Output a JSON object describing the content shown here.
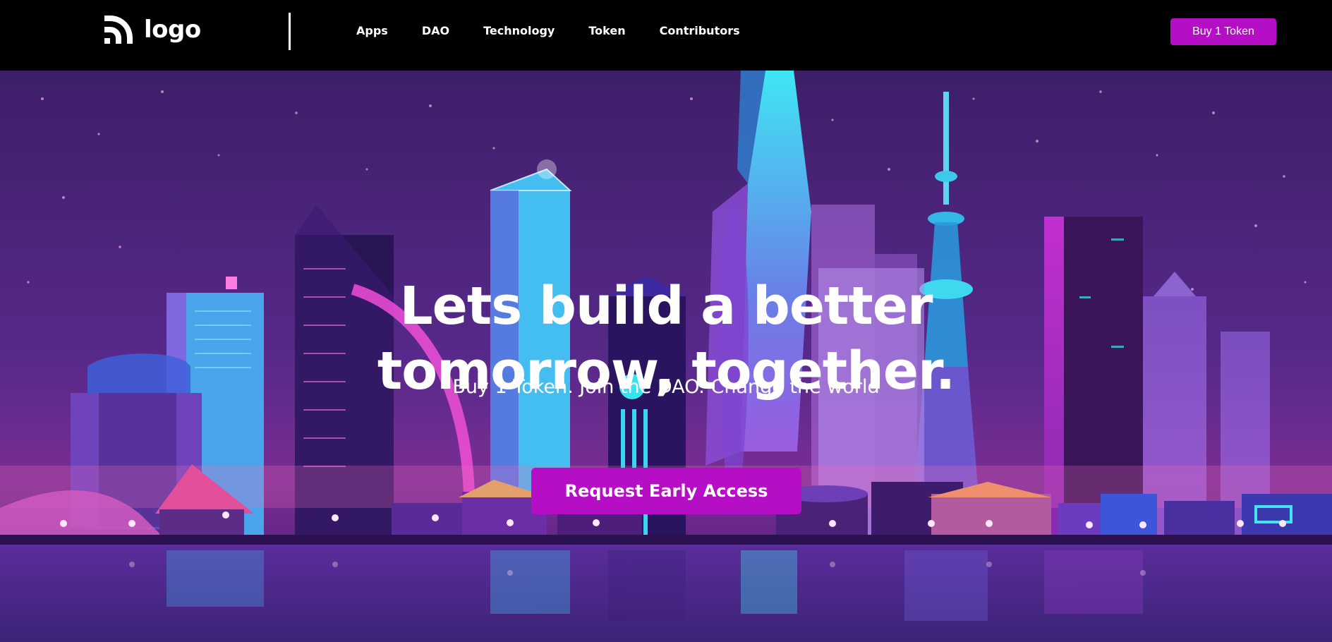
{
  "header": {
    "logo_text": "logo",
    "nav": [
      {
        "label": "Apps"
      },
      {
        "label": "DAO"
      },
      {
        "label": "Technology"
      },
      {
        "label": "Token"
      },
      {
        "label": "Contributors"
      }
    ],
    "cta_label": "Buy 1 Token"
  },
  "hero": {
    "title_line1": "Lets build a better",
    "title_line2": "tomorrow, together.",
    "subtitle": "Buy 1 Token. Join the DAO. Change the world",
    "cta_label": "Request Early Access"
  },
  "colors": {
    "accent": "#b50ec4",
    "header_bg": "#000000",
    "text": "#ffffff"
  },
  "icons": {
    "logo": "rss-arc-logo-icon"
  }
}
